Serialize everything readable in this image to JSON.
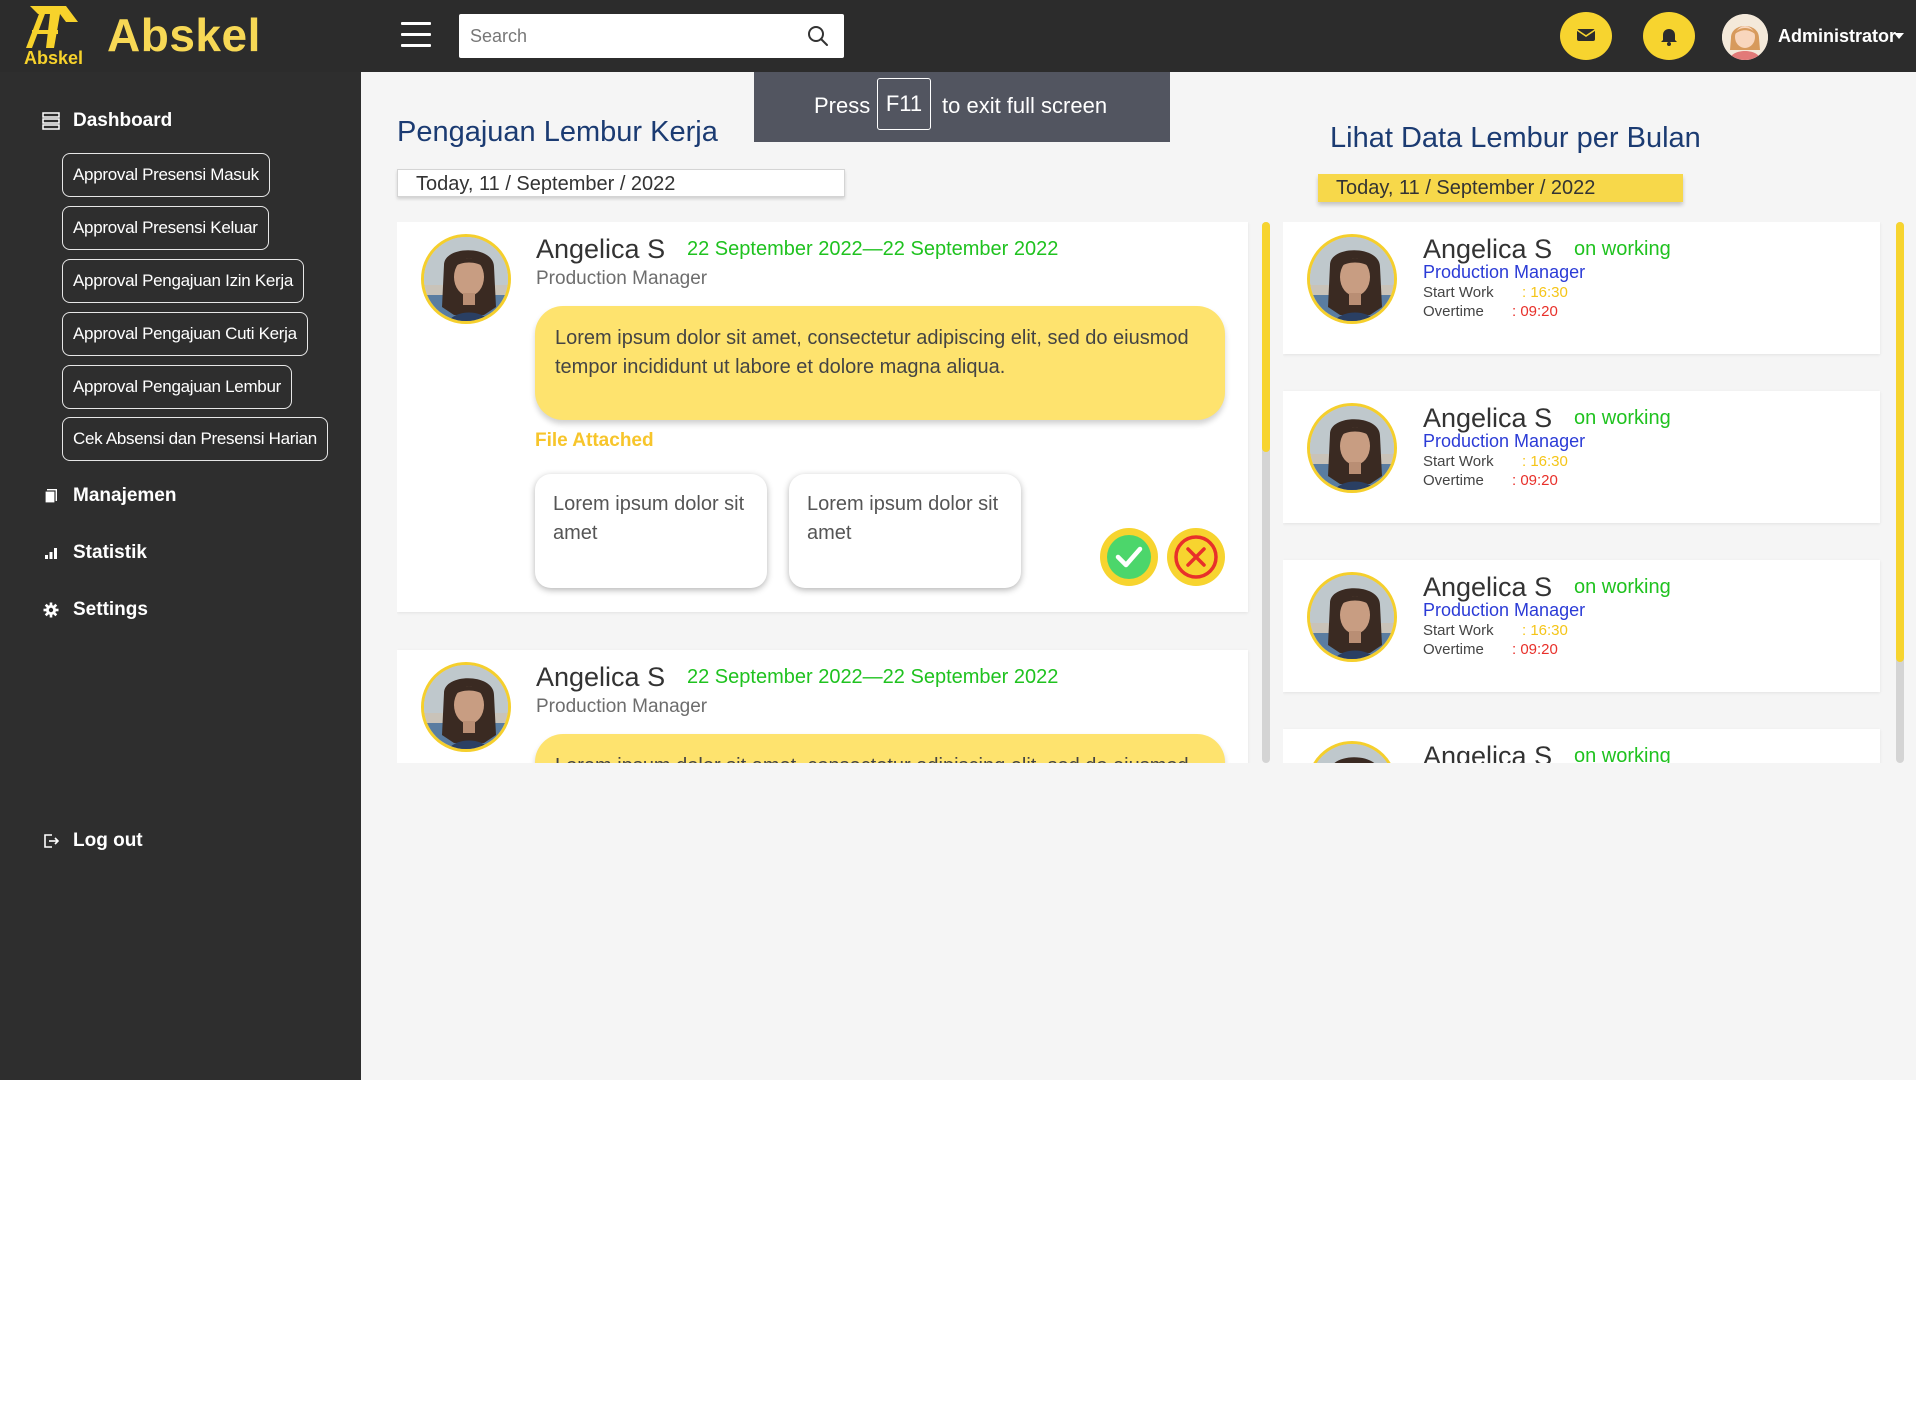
{
  "app": {
    "brand": "Abskel",
    "logo_text": "Abskel"
  },
  "header": {
    "search_placeholder": "Search",
    "user_name": "Administrator",
    "icons": {
      "menu": "hamburger-icon",
      "search": "search-icon",
      "mail": "mail-icon",
      "notifications": "bell-icon",
      "account_caret": "caret-down-icon"
    }
  },
  "sidebar": {
    "dashboard": {
      "label": "Dashboard",
      "icon": "server-icon"
    },
    "sub_items": [
      {
        "label": "Approval Presensi Masuk"
      },
      {
        "label": "Approval Presensi Keluar"
      },
      {
        "label": "Approval Pengajuan Izin Kerja"
      },
      {
        "label": "Approval Pengajuan Cuti Kerja"
      },
      {
        "label": "Approval Pengajuan Lembur"
      },
      {
        "label": "Cek Absensi dan Presensi Harian"
      }
    ],
    "manajemen": {
      "label": "Manajemen",
      "icon": "copy-icon"
    },
    "statistik": {
      "label": "Statistik",
      "icon": "signal-bars-icon"
    },
    "settings": {
      "label": "Settings",
      "icon": "gear-icon"
    },
    "logout": {
      "label": "Log out",
      "icon": "logout-icon"
    }
  },
  "fullscreen_banner": {
    "press": "Press",
    "key": "F11",
    "text": "to exit full screen"
  },
  "left_section": {
    "title": "Pengajuan Lembur Kerja",
    "date": "Today, 11 / September / 2022",
    "requests": [
      {
        "name": "Angelica S",
        "date_range": "22 September 2022—22 September 2022",
        "role": "Production Manager",
        "message": "Lorem ipsum dolor sit amet, consectetur adipiscing elit, sed do eiusmod tempor incididunt ut labore et dolore magna aliqua.",
        "file_label": "File Attached",
        "files": [
          "Lorem ipsum dolor sit amet",
          "Lorem ipsum dolor sit amet"
        ]
      },
      {
        "name": "Angelica S",
        "date_range": "22 September 2022—22 September 2022",
        "role": "Production Manager",
        "message": "Lorem ipsum dolor sit amet, consectetur adipiscing elit, sed do eiusmod tempor incididunt ut labore et dolore magna aliqua."
      }
    ]
  },
  "right_section": {
    "title": "Lihat Data Lembur per Bulan",
    "date": "Today, 11 / September / 2022",
    "start_label": "Start Work",
    "overtime_label": "Overtime",
    "employees": [
      {
        "name": "Angelica S",
        "status": "on working",
        "role": "Production Manager",
        "start": ": 16:30",
        "overtime": ": 09:20"
      },
      {
        "name": "Angelica S",
        "status": "on working",
        "role": "Production Manager",
        "start": ": 16:30",
        "overtime": ": 09:20"
      },
      {
        "name": "Angelica S",
        "status": "on working",
        "role": "Production Manager",
        "start": ": 16:30",
        "overtime": ": 09:20"
      },
      {
        "name": "Angelica S",
        "status": "on working"
      }
    ]
  },
  "colors": {
    "accent_yellow": "#f7d42f",
    "sidebar_bg": "#2e2e2e",
    "title_blue": "#1b3b72",
    "status_green": "#1fc21f",
    "overtime_red": "#e8302a",
    "start_yellow": "#f5c518"
  }
}
